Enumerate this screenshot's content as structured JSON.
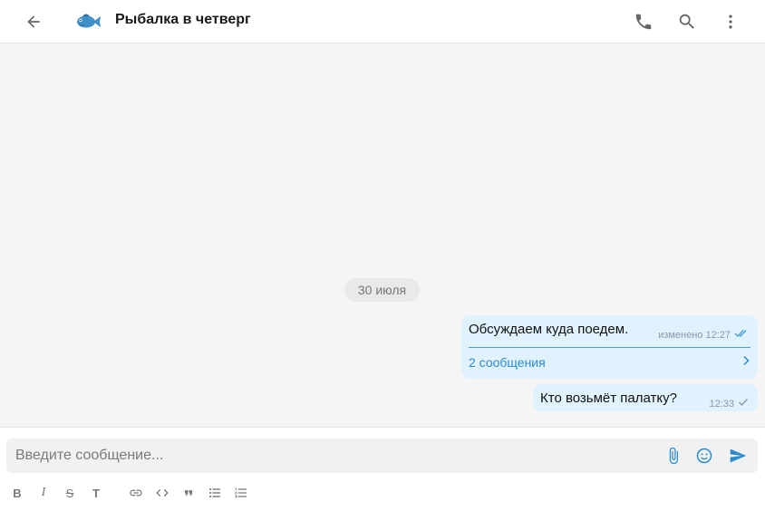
{
  "header": {
    "title": "Рыбалка в четверг",
    "icons": [
      "back-arrow-icon",
      "fish-icon",
      "phone-icon",
      "search-icon",
      "more-vertical-icon"
    ]
  },
  "timeline": {
    "date_separator": "30 июля",
    "messages": [
      {
        "text": "Обсуждаем куда поедем.",
        "status": "изменено 12:27",
        "read_state": "double-check",
        "thread_label": "2 сообщения"
      },
      {
        "text": "Кто возьмёт палатку?",
        "status": "12:33",
        "read_state": "single-check"
      }
    ]
  },
  "composer": {
    "placeholder": "Введите сообщение...",
    "toolbar": {
      "bold": "B",
      "italic": "I",
      "strike": "S",
      "heading": "T"
    }
  },
  "colors": {
    "accent": "#2a8bd1",
    "bubble": "#dff2fd",
    "background": "#f5f5f5"
  }
}
